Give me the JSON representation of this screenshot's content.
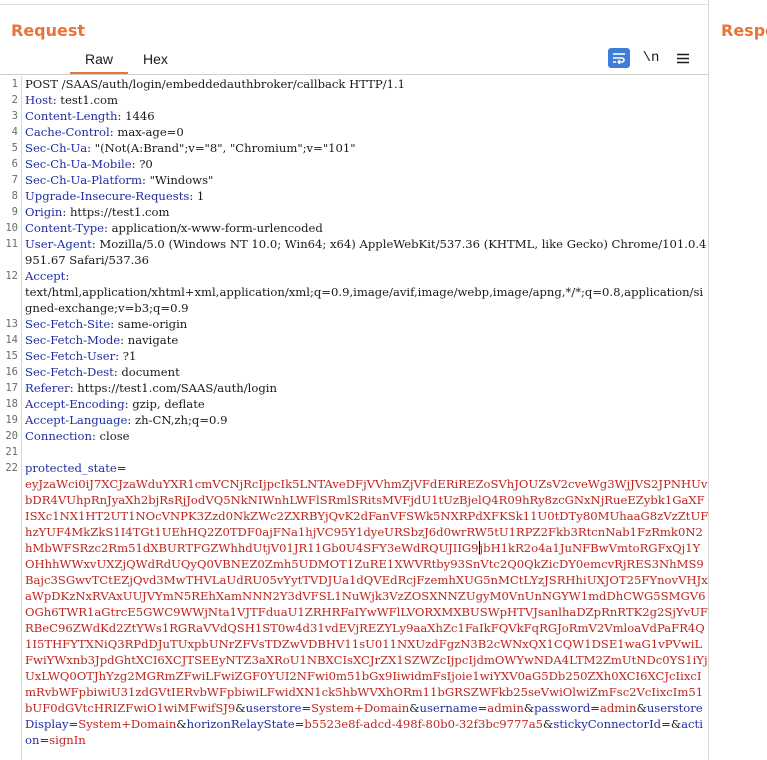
{
  "request_panel": {
    "title": "Request",
    "tabs": [
      {
        "label": "Raw",
        "active": true
      },
      {
        "label": "Hex",
        "active": false
      }
    ],
    "toolbar": {
      "wrap_icon": "wrap-lines-icon",
      "newline_label": "\\n",
      "menu_icon": "hamburger-menu-icon"
    }
  },
  "response_panel": {
    "title_visible": "Respo"
  },
  "colors": {
    "accent": "#e8743b",
    "header_key": "#1d2ea6",
    "body_value": "#c0261f",
    "wrap_button": "#3f7ed8"
  },
  "request_line": "POST /SAAS/auth/login/embeddedauthbroker/callback HTTP/1.1",
  "headers": [
    {
      "key": "Host",
      "value": "test1.com"
    },
    {
      "key": "Content-Length",
      "value": "1446"
    },
    {
      "key": "Cache-Control",
      "value": "max-age=0"
    },
    {
      "key": "Sec-Ch-Ua",
      "value": "\"(Not(A:Brand\";v=\"8\", \"Chromium\";v=\"101\""
    },
    {
      "key": "Sec-Ch-Ua-Mobile",
      "value": "?0"
    },
    {
      "key": "Sec-Ch-Ua-Platform",
      "value": "\"Windows\""
    },
    {
      "key": "Upgrade-Insecure-Requests",
      "value": "1"
    },
    {
      "key": "Origin",
      "value": "https://test1.com"
    },
    {
      "key": "Content-Type",
      "value": "application/x-www-form-urlencoded"
    },
    {
      "key": "User-Agent",
      "value": "Mozilla/5.0 (Windows NT 10.0; Win64; x64) AppleWebKit/537.36 (KHTML, like Gecko) Chrome/101.0.4951.67 Safari/537.36"
    },
    {
      "key": "Accept",
      "value": "\ntext/html,application/xhtml+xml,application/xml;q=0.9,image/avif,image/webp,image/apng,*/*;q=0.8,application/signed-exchange;v=b3;q=0.9"
    },
    {
      "key": "Sec-Fetch-Site",
      "value": "same-origin"
    },
    {
      "key": "Sec-Fetch-Mode",
      "value": "navigate"
    },
    {
      "key": "Sec-Fetch-User",
      "value": "?1"
    },
    {
      "key": "Sec-Fetch-Dest",
      "value": "document"
    },
    {
      "key": "Referer",
      "value": "https://test1.com/SAAS/auth/login"
    },
    {
      "key": "Accept-Encoding",
      "value": "gzip, deflate"
    },
    {
      "key": "Accept-Language",
      "value": "zh-CN,zh;q=0.9"
    },
    {
      "key": "Connection",
      "value": "close"
    }
  ],
  "line_numbers": {
    "request": "1",
    "headers": [
      "2",
      "3",
      "4",
      "5",
      "6",
      "7",
      "8",
      "9",
      "10",
      "11",
      "12",
      "13",
      "14",
      "15",
      "16",
      "17",
      "18",
      "19",
      "20"
    ],
    "blank": "21",
    "body": "22"
  },
  "body": {
    "before_caret": "eyJzaWci0iJ7XCJzaWduYXR1cmVCNjRcIjpcIk5LNTAveDFjVVhmZjVFdERiREZoSVhJOUZsV2cveWg3WjJVS2JPNHUvbDR4VUhpRnJyaXh2bjRsRjJodVQ5NkNIWnhLWFlSRmlSRitsMVFjdU1tUzBjelQ4R09hRy8zcGNxNjRueEZybk1GaXFISXc1NX1HT2UT1NOcVNPK3Zzd0NkZWc2ZXRBYjQvK2dFanVFSWk5NXRPdXFKSk11U0tDTy80MUhaaG8zVzZtUFhzYUF4MkZkS1I4TGt1UEhHQ2Z0TDF0ajFNa1hjVC95Y1dyeURSbzJ6d0wrRW5tU1RPZ2Fkb3RtcnNab1FzRmk0N2hMbWFSRzc2Rm51dXBURTFGZWhhdUtjV01JR11Gb0U4SFY3eWdRQUJIIG9",
    "after_caret": "jbH1kR2o4a1JuNFBwVmtoRGFxQj1YOHhhWWxvUXZjQWdRdUQyQ0VBNEZ0Zmh5UDMOT1ZuRE1XWVRtby93SnVtc2Q0QkZicDY0emcvRjRES3NhMS9Bajc3SGwvTCtEZjQvd3MwTHVLaUdRU05vYytTVDJUa1dQVEdRcjFzemhXUG5nMCtLYzJSRHhiUXJOT25FYnovVHJxaWpDKzNxRVAxUUJVYmN5REhXamNNN2Y3dVFSL1NuWjk3VzZOSXNNZUgyM0VnUnNGYW1mdDhCWG5SMGV6OGh6TWR1aGtrcE5GWC9WWjNta1VJTFduaU1ZRHRFaIYwWFlLVORXMXBUSWpHTVJsanlhaDZpRnRTK2g2SjYvUFRBeC96ZWdKd2ZtYWs1RGRaVVdQSH1ST0w4d31vdEVjREZYLy9aaXhZc1FaIkFQVkFqRGJoRmV2VmloaVdPaFR4Q1I5THFYTXNiQ3RPdDJuTUxpbUNrZFVsTDZwVDBHV11sU011NXUzdFgzN3B2cWNxQX1CQW1DSE1waG1vPVwiLFwiYWxnb3JpdGhtXCI6XCJTSEEyNTZ3aXRoU1NBXCIsXCJrZX1SZWZcIjpcIjdmOWYwNDA4LTM2ZmUtNDc0YS1iYjUxLWQ0OTJhYzg2MGRmZFwiLFwiZGF0YUI2NFwi0m51bGx9IiwidmFsIjoie1wiYXV0aG5Db250ZXh0XCI6XCJcIixcImRvbWFpbiwiU31zdGVtIERvbWFpbiwiLFwidXN1ck5hbWVXhORm11bGRSZWFkb25seVwiOlwiZmFsc2VcIixcIm51bUF0dGVtcHRIZFwiO1wiMFwifSJ9"
  },
  "body_params": [
    {
      "key": "userstore",
      "value": "System+Domain"
    },
    {
      "key": "username",
      "value": "admin"
    },
    {
      "key": "password",
      "value": "admin"
    },
    {
      "key": "userstoreDisplay",
      "value": "System+Domain"
    },
    {
      "key": "horizonRelayState",
      "value": "b5523e8f-adcd-498f-80b0-32f3bc9777a5"
    },
    {
      "key": "stickyConnectorId",
      "value": ""
    },
    {
      "key": "action",
      "value": "signIn"
    }
  ],
  "protected_state_key": "protected_state"
}
